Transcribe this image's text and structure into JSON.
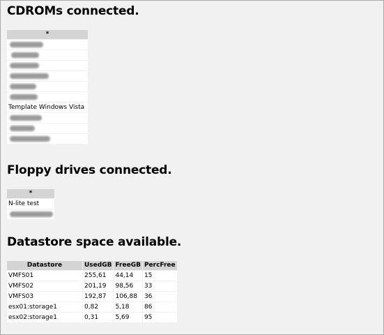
{
  "sections": {
    "cdrom": {
      "title": "CDROMs connected.",
      "column": "*",
      "visible_items": [
        "Template Windows Vista"
      ]
    },
    "floppy": {
      "title": "Floppy drives connected.",
      "column": "*",
      "visible_items": [
        "N-lite test"
      ]
    },
    "datastore": {
      "title": "Datastore space available.",
      "columns": [
        "Datastore",
        "UsedGB",
        "FreeGB",
        "PercFree"
      ],
      "rows": [
        [
          "VMFS01",
          "255,61",
          "44,14",
          "15"
        ],
        [
          "VMFS02",
          "201,19",
          "98,56",
          "33"
        ],
        [
          "VMFS03",
          "192,87",
          "106,88",
          "36"
        ],
        [
          "esx01:storage1",
          "0,82",
          "5,18",
          "86"
        ],
        [
          "esx02:storage1",
          "0,31",
          "5,69",
          "95"
        ]
      ]
    }
  }
}
